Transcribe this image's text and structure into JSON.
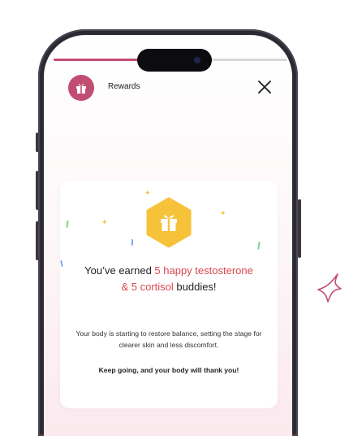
{
  "header": {
    "title": "Rewards",
    "progress_fraction": 0.58
  },
  "reward": {
    "earned_prefix": "You’ve earned ",
    "earned_highlight_1": "5 happy testosterone",
    "earned_connector": "& ",
    "earned_highlight_2": "5 cortisol",
    "earned_suffix": " buddies!",
    "description": "Your body is starting to restore balance, setting the stage for clearer skin and less discomfort.",
    "encouragement": "Keep going, and your body will thank you!"
  },
  "colors": {
    "accent": "#c24d72",
    "highlight": "#d8484f",
    "badge": "#f5c23a"
  },
  "icons": {
    "header_icon": "gift-icon",
    "close": "close-icon",
    "badge_icon": "gift-icon",
    "decoration": "sparkle-outline-icon"
  }
}
